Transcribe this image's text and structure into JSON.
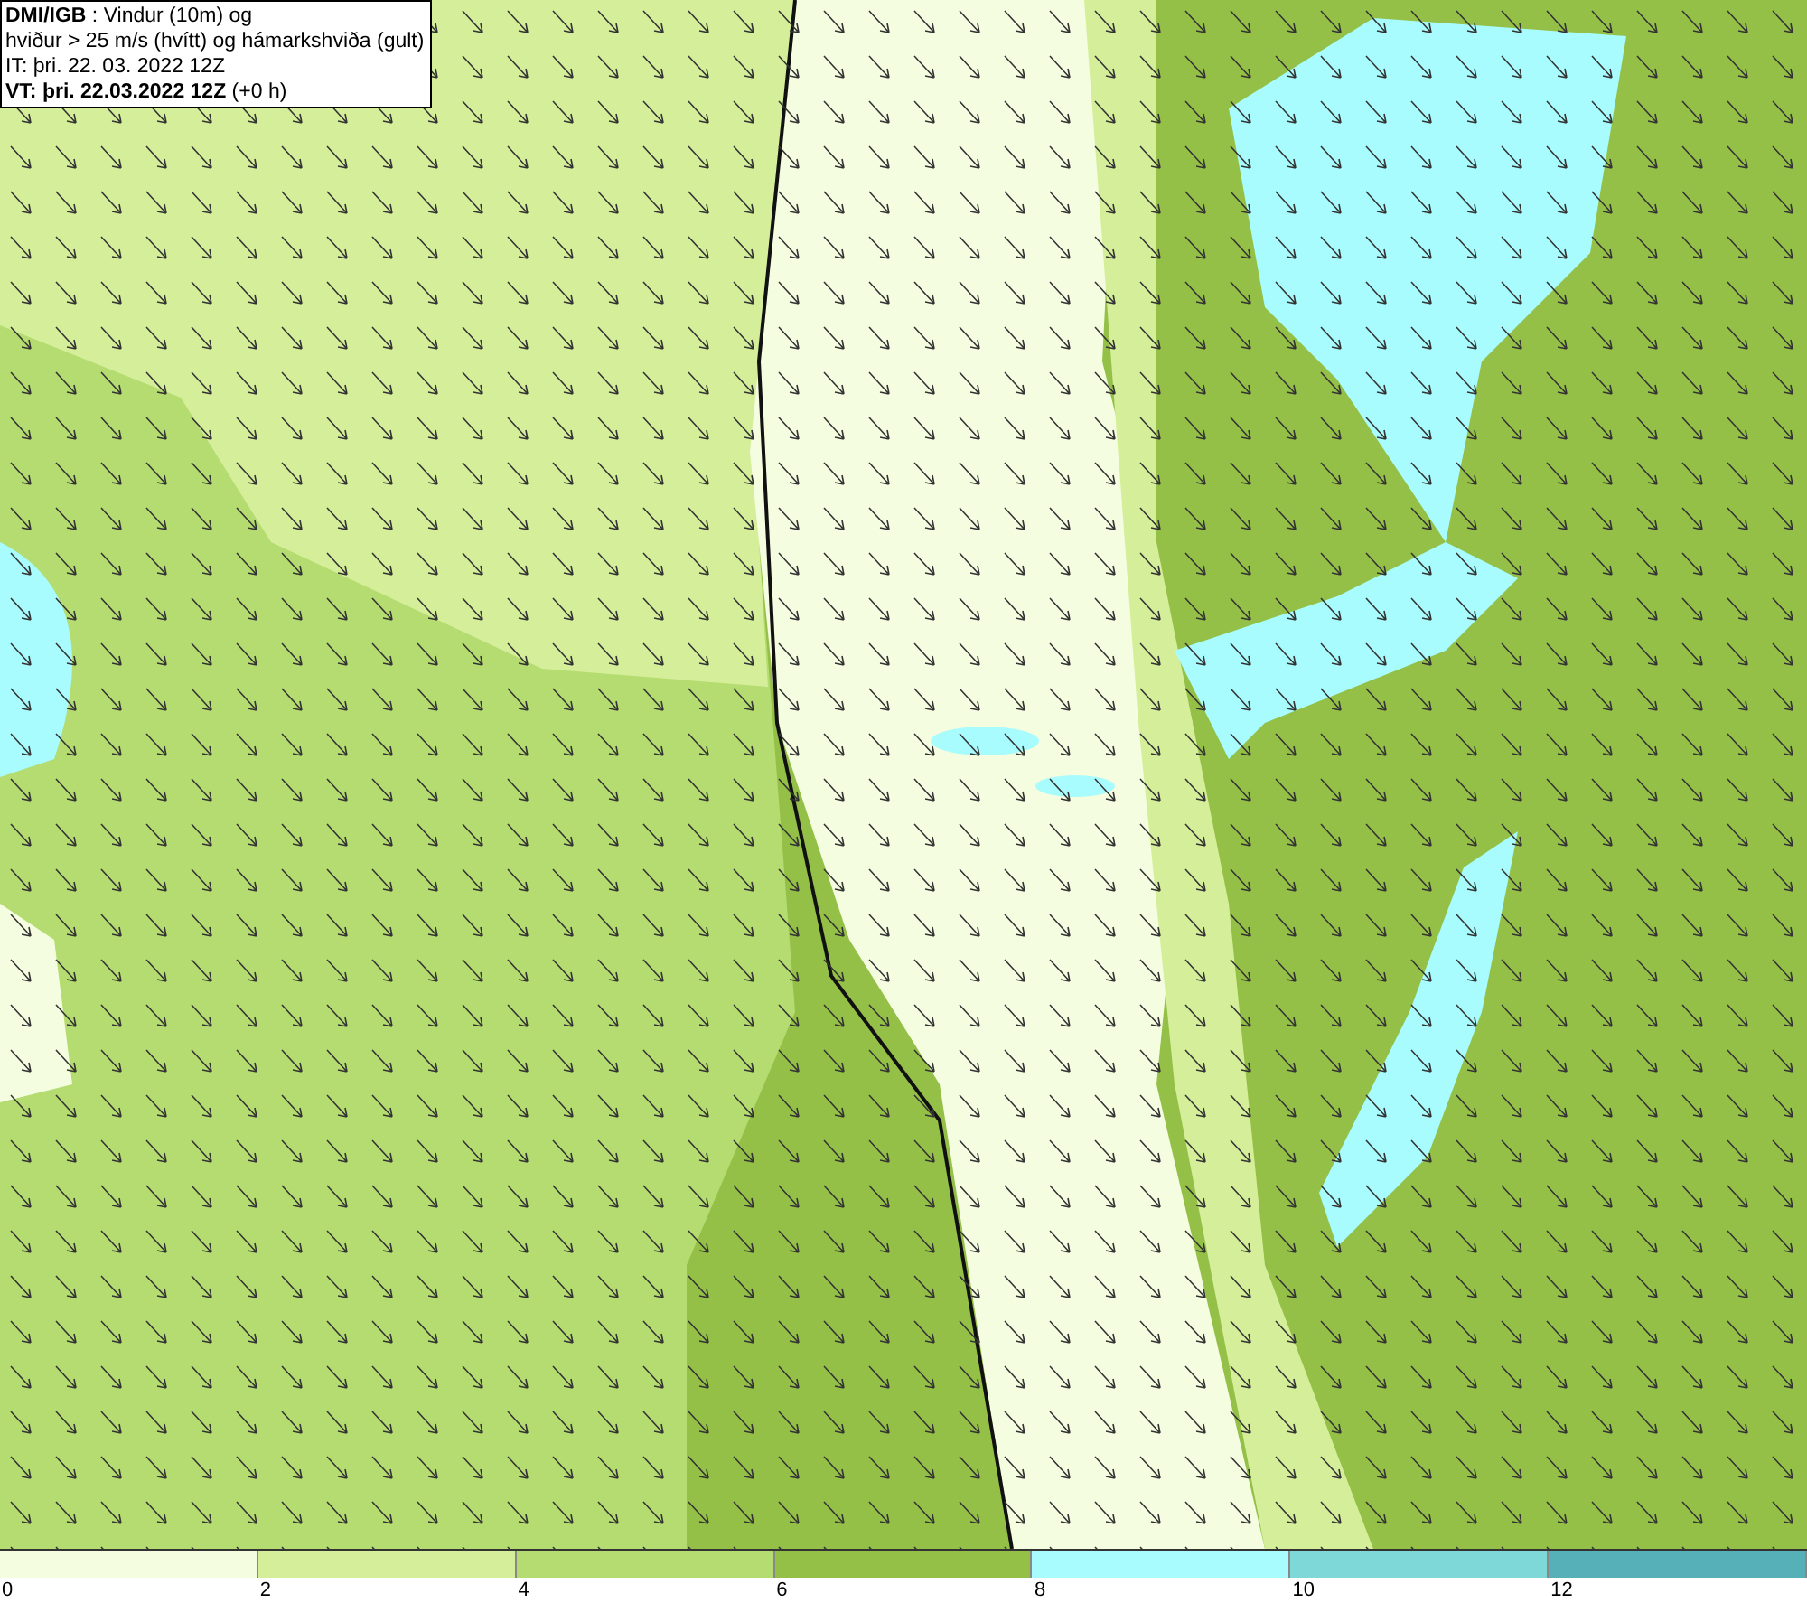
{
  "header": {
    "lines": [
      "**DMI/IGB** : Vindur (10m) og",
      "hviður > 25 m/s (hvítt) og hámarkshviða (gult)",
      "IT: þri. 22. 03. 2022 12Z",
      "**VT: þri. 22.03.2022 12Z** (+0 h)"
    ]
  },
  "legend": {
    "segments": [
      {
        "color": "#f5fde0"
      },
      {
        "color": "#d5ee9a"
      },
      {
        "color": "#b5dc70"
      },
      {
        "color": "#94c048"
      },
      {
        "color": "#a8fcfd"
      },
      {
        "color": "#7fd8d8"
      },
      {
        "color": "#55b0b8"
      }
    ],
    "ticks": [
      "0",
      "2",
      "4",
      "6",
      "8",
      "10",
      "12"
    ]
  }
}
